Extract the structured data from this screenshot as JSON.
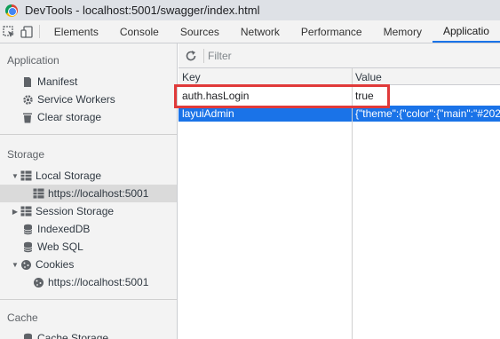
{
  "window": {
    "title": "DevTools - localhost:5001/swagger/index.html"
  },
  "tabs": [
    "Elements",
    "Console",
    "Sources",
    "Network",
    "Performance",
    "Memory",
    "Applicatio"
  ],
  "sidebar": {
    "application_header": "Application",
    "application_items": [
      "Manifest",
      "Service Workers",
      "Clear storage"
    ],
    "storage_header": "Storage",
    "storage_items": {
      "local_storage": "Local Storage",
      "local_storage_child": "https://localhost:5001",
      "session_storage": "Session Storage",
      "indexeddb": "IndexedDB",
      "websql": "Web SQL",
      "cookies": "Cookies",
      "cookies_child": "https://localhost:5001"
    },
    "cache_header": "Cache",
    "cache_items": [
      "Cache Storage"
    ]
  },
  "filter": {
    "placeholder": "Filter"
  },
  "table": {
    "columns": [
      "Key",
      "Value"
    ],
    "rows": [
      {
        "key": "auth.hasLogin",
        "value": "true"
      },
      {
        "key": "layuiAdmin",
        "value": "{\"theme\":{\"color\":{\"main\":\"#202"
      }
    ]
  },
  "colors": {
    "accent": "#1a73e8",
    "highlight": "#e03a3a"
  }
}
